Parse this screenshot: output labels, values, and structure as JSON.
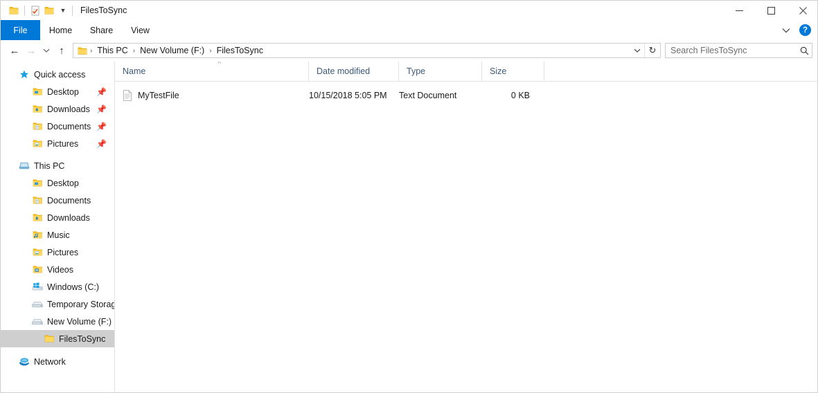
{
  "window": {
    "title": "FilesToSync",
    "quick_access_toolbar": [
      {
        "name": "properties-folder-icon",
        "icon": "folder"
      },
      {
        "name": "properties-icon",
        "icon": "properties"
      },
      {
        "name": "new-folder-icon",
        "icon": "folder"
      },
      {
        "name": "customize-dropdown-icon",
        "icon": "caret-down"
      }
    ],
    "controls": {
      "minimize": "─",
      "maximize": "□",
      "close": "✕"
    }
  },
  "ribbon": {
    "tabs": [
      {
        "label": "File",
        "active": true
      },
      {
        "label": "Home",
        "active": false
      },
      {
        "label": "Share",
        "active": false
      },
      {
        "label": "View",
        "active": false
      }
    ],
    "expand_icon": "chevron-down",
    "help_label": "?"
  },
  "address": {
    "back_icon": "←",
    "forward_icon": "→",
    "recent_icon": "⌄",
    "up_icon": "↑",
    "breadcrumb": [
      {
        "label": "This PC"
      },
      {
        "label": "New Volume (F:)"
      },
      {
        "label": "FilesToSync"
      }
    ],
    "separator": "›",
    "history_icon": "⌄",
    "refresh_icon": "↻"
  },
  "search": {
    "placeholder": "Search FilesToSync",
    "value": ""
  },
  "navpane": {
    "groups": [
      {
        "header": {
          "label": "Quick access",
          "icon": "star-icon",
          "level": 0
        },
        "items": [
          {
            "label": "Desktop",
            "icon": "folder-desktop-icon",
            "pinned": true,
            "level": 1
          },
          {
            "label": "Downloads",
            "icon": "folder-downloads-icon",
            "pinned": true,
            "level": 1
          },
          {
            "label": "Documents",
            "icon": "folder-documents-icon",
            "pinned": true,
            "level": 1
          },
          {
            "label": "Pictures",
            "icon": "folder-pictures-icon",
            "pinned": true,
            "level": 1
          }
        ]
      },
      {
        "header": {
          "label": "This PC",
          "icon": "this-pc-icon",
          "level": 0
        },
        "items": [
          {
            "label": "Desktop",
            "icon": "folder-desktop-icon",
            "pinned": false,
            "level": 1
          },
          {
            "label": "Documents",
            "icon": "folder-documents-icon",
            "pinned": false,
            "level": 1
          },
          {
            "label": "Downloads",
            "icon": "folder-downloads-icon",
            "pinned": false,
            "level": 1
          },
          {
            "label": "Music",
            "icon": "folder-music-icon",
            "pinned": false,
            "level": 1
          },
          {
            "label": "Pictures",
            "icon": "folder-pictures-icon",
            "pinned": false,
            "level": 1
          },
          {
            "label": "Videos",
            "icon": "folder-videos-icon",
            "pinned": false,
            "level": 1
          },
          {
            "label": "Windows (C:)",
            "icon": "drive-windows-icon",
            "pinned": false,
            "level": 1
          },
          {
            "label": "Temporary Storage (",
            "icon": "drive-icon",
            "pinned": false,
            "level": 1
          },
          {
            "label": "New Volume (F:)",
            "icon": "drive-icon",
            "pinned": false,
            "level": 1
          },
          {
            "label": "FilesToSync",
            "icon": "folder-icon",
            "pinned": false,
            "level": 2,
            "selected": true
          }
        ]
      },
      {
        "header": {
          "label": "Network",
          "icon": "network-icon",
          "level": 0
        },
        "items": []
      }
    ]
  },
  "filelist": {
    "columns": [
      {
        "label": "Name",
        "key": "name",
        "sorted": "asc"
      },
      {
        "label": "Date modified",
        "key": "date"
      },
      {
        "label": "Type",
        "key": "type"
      },
      {
        "label": "Size",
        "key": "size"
      }
    ],
    "sort_caret": "˄",
    "rows": [
      {
        "name": "MyTestFile",
        "date": "10/15/2018 5:05 PM",
        "type": "Text Document",
        "size": "0 KB",
        "icon": "text-document-icon"
      }
    ]
  },
  "colors": {
    "accent": "#0078d7",
    "folder": "#fcc21b",
    "header_text": "#3c5a78",
    "selection": "#cfcfcf"
  }
}
